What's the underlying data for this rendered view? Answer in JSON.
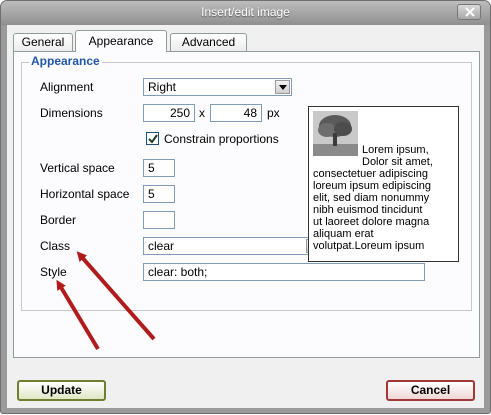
{
  "window": {
    "title": "Insert/edit image"
  },
  "tabs": [
    {
      "label": "General",
      "active": false
    },
    {
      "label": "Appearance",
      "active": true
    },
    {
      "label": "Advanced",
      "active": false
    }
  ],
  "fieldset": {
    "legend": "Appearance"
  },
  "form": {
    "alignment": {
      "label": "Alignment",
      "value": "Right"
    },
    "dimensions": {
      "label": "Dimensions",
      "width": "250",
      "separator": "x",
      "height": "48",
      "unit": "px"
    },
    "constrain": {
      "label": "Constrain proportions",
      "checked": true
    },
    "vertical_space": {
      "label": "Vertical space",
      "value": "5"
    },
    "horizontal_space": {
      "label": "Horizontal space",
      "value": "5"
    },
    "border": {
      "label": "Border",
      "value": ""
    },
    "class": {
      "label": "Class",
      "value": "clear"
    },
    "style": {
      "label": "Style",
      "value": "clear: both;"
    }
  },
  "preview": {
    "lines": [
      "Lorem ipsum,",
      "Dolor sit amet,",
      "consectetuer adipiscing",
      "loreum ipsum edipiscing",
      "elit, sed diam nonummy",
      "nibh euismod tincidunt",
      "ut laoreet dolore magna",
      "aliquam erat",
      "volutpat.Loreum ipsum"
    ]
  },
  "buttons": {
    "update": "Update",
    "cancel": "Cancel"
  },
  "icons": {
    "close": "close-icon",
    "dropdown": "chevron-down-icon",
    "check": "checkmark-icon",
    "tree": "tree-image"
  },
  "colors": {
    "legend": "#2257a8",
    "annotation_arrow": "#b01b1b",
    "update_border": "#6f7f2f",
    "cancel_border": "#a33838"
  }
}
